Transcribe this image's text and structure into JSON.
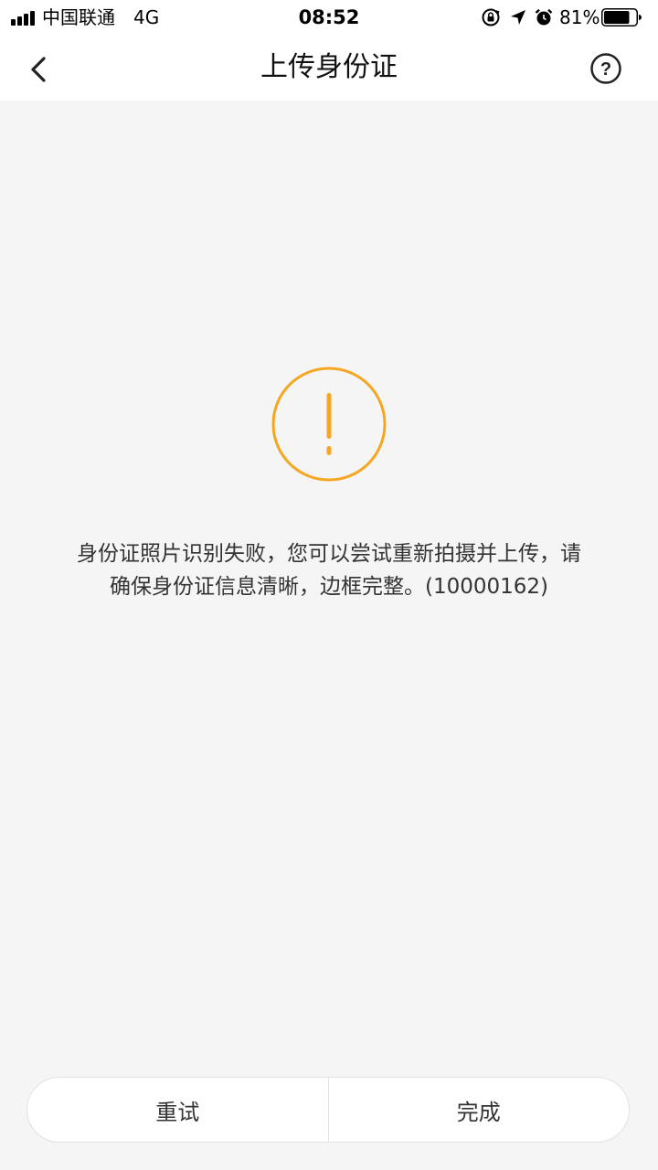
{
  "status_bar": {
    "carrier": "中国联通",
    "network": "4G",
    "time": "08:52",
    "battery_percent": "81%",
    "battery_level": 0.81,
    "icons": [
      "signal-icon",
      "rotation-lock-icon",
      "location-icon",
      "alarm-icon",
      "battery-icon"
    ]
  },
  "nav": {
    "back_icon": "chevron-left-icon",
    "title": "上传身份证",
    "help_icon": "question-circle-icon",
    "help_symbol": "?"
  },
  "alert": {
    "icon": "exclamation-circle-icon",
    "color": "#F5A623",
    "message_line1": "身份证照片识别失败，您可以尝试重新拍摄并上传，请",
    "message_line2": "确保身份证信息清晰，边框完整。(10000162)"
  },
  "actions": {
    "retry_label": "重试",
    "done_label": "完成"
  },
  "colors": {
    "background": "#F5F5F5",
    "surface": "#FFFFFF",
    "text": "#333333",
    "accent": "#F5A623"
  }
}
